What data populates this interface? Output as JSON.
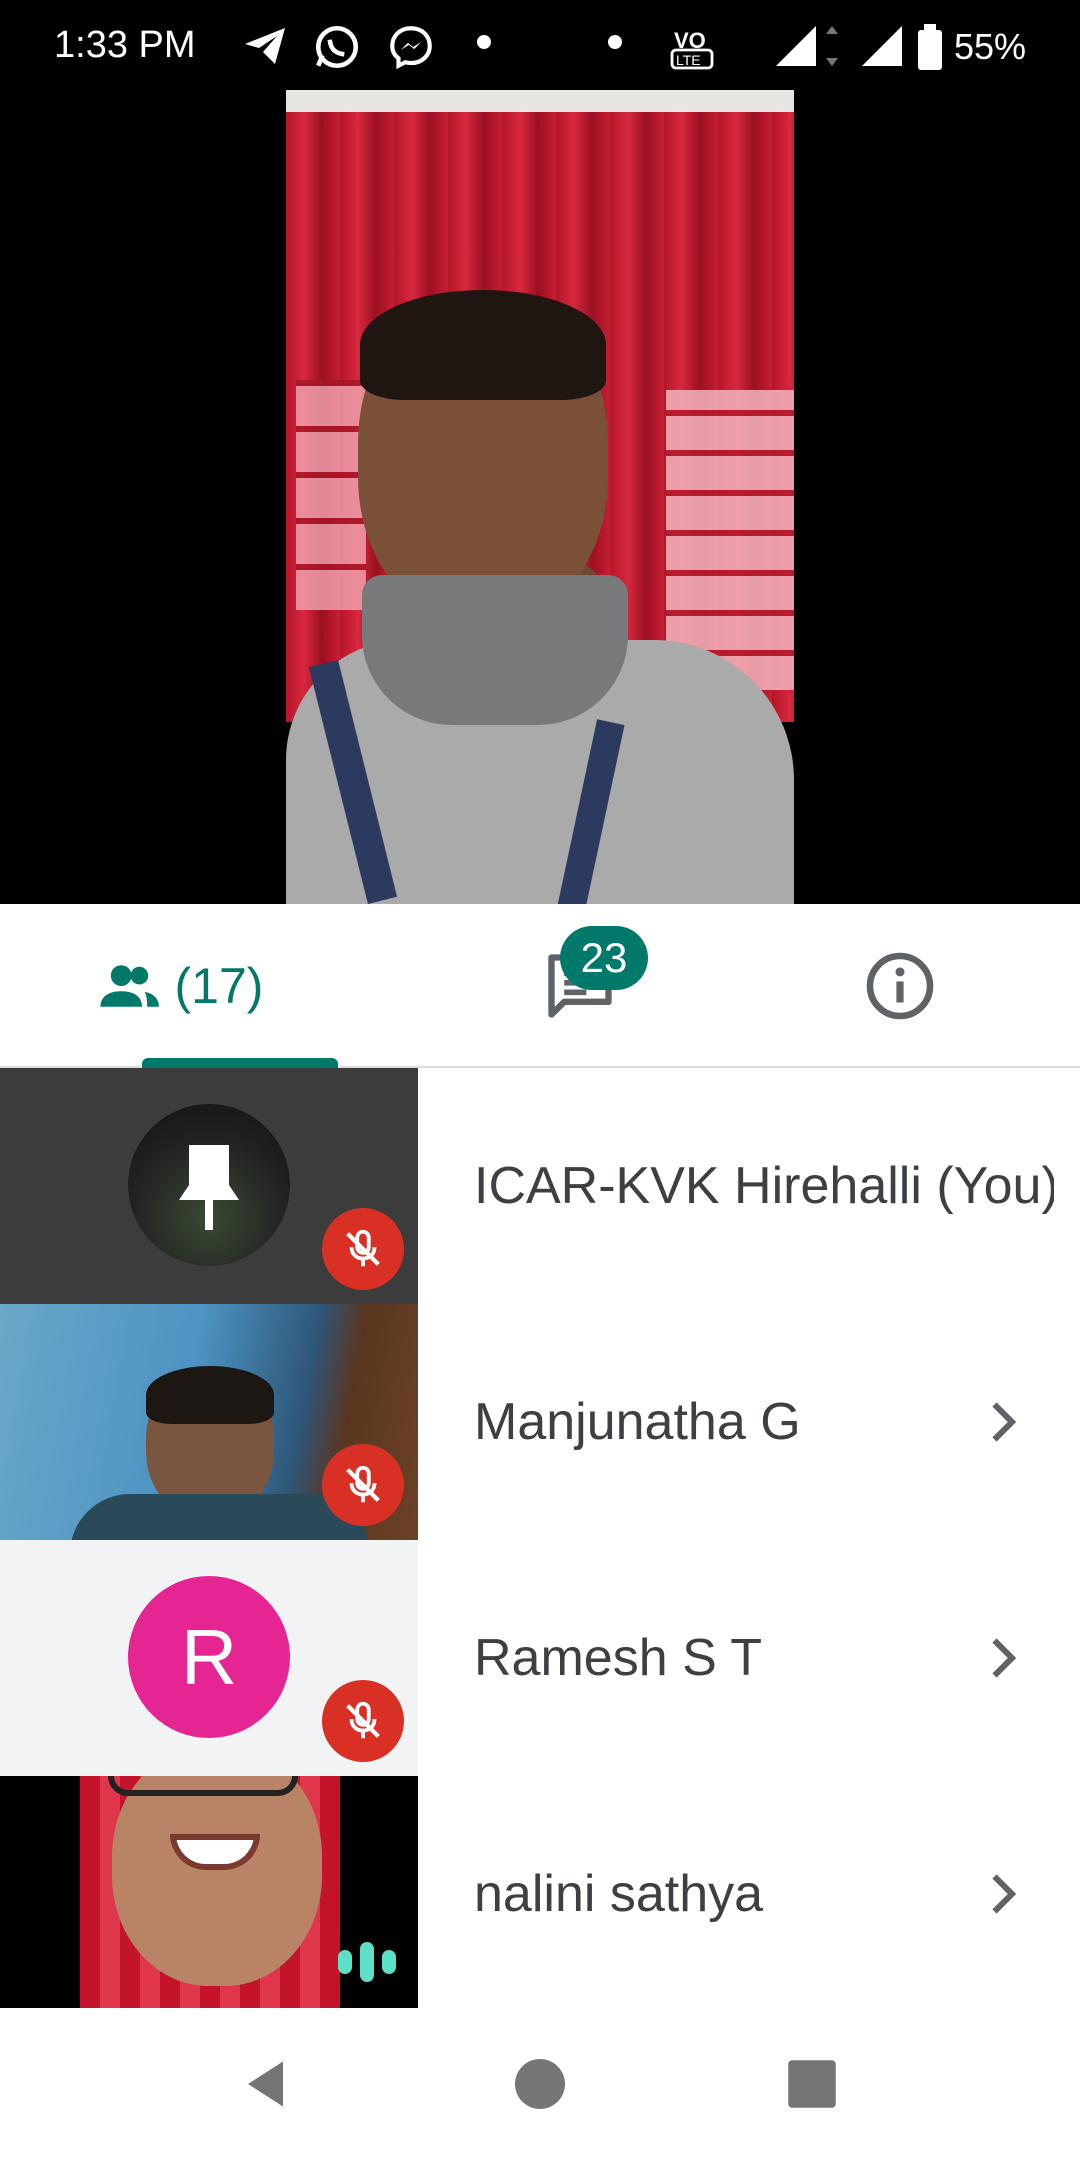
{
  "status_bar": {
    "time": "1:33 PM",
    "battery": "55%",
    "icons": [
      "telegram-icon",
      "whatsapp-icon",
      "messenger-icon",
      "dot-icon",
      "dot-icon",
      "volte-icon",
      "signal-icon",
      "signal-icon",
      "battery-icon"
    ]
  },
  "tabs": {
    "people_count": "(17)",
    "chat_badge": "23",
    "icons": [
      "people-icon",
      "chat-icon",
      "info-icon"
    ]
  },
  "participants": [
    {
      "name": "ICAR-KVK Hirehalli (You)",
      "muted": true,
      "avatar": "photo"
    },
    {
      "name": "Manjunatha G",
      "muted": true,
      "avatar": "video"
    },
    {
      "name": "Ramesh S T",
      "muted": true,
      "avatar": "letter",
      "initial": "R",
      "color": "#e52592"
    },
    {
      "name": "nalini sathya",
      "muted": false,
      "speaking": true,
      "avatar": "video"
    }
  ],
  "colors": {
    "accent": "#00796b",
    "mute": "#d93025",
    "speaking": "#5ce0c6"
  }
}
